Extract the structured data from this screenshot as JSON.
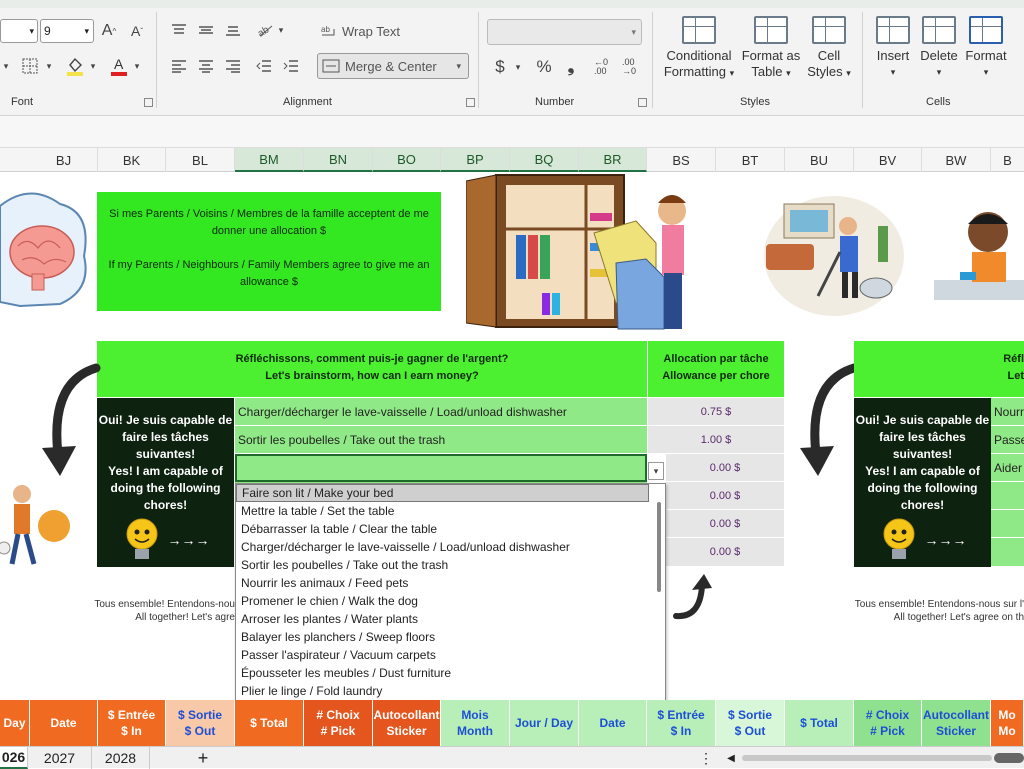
{
  "ribbon": {
    "font_size": "9",
    "font_group": "Font",
    "alignment_group": "Alignment",
    "number_group": "Number",
    "styles_group": "Styles",
    "cells_group": "Cells",
    "wrap_text": "Wrap Text",
    "merge_center": "Merge & Center",
    "conditional_formatting_1": "Conditional",
    "conditional_formatting_2": "Formatting",
    "format_as_table_1": "Format as",
    "format_as_table_2": "Table",
    "cell_styles_1": "Cell",
    "cell_styles_2": "Styles",
    "insert": "Insert",
    "delete": "Delete",
    "format": "Format"
  },
  "columns": [
    "BJ",
    "BK",
    "BL",
    "BM",
    "BN",
    "BO",
    "BP",
    "BQ",
    "BR",
    "BS",
    "BT",
    "BU",
    "BV",
    "BW",
    "B"
  ],
  "note": {
    "fr": "Si mes Parents / Voisins / Membres de la famille acceptent de me donner une allocation $",
    "en": "If my Parents / Neighbours / Family Members agree to give me an allowance $"
  },
  "brainstorm": {
    "fr": "Réfléchissons, comment puis-je gagner de l'argent?",
    "en": "Let's brainstorm, how can I earn money?"
  },
  "allowance_header": {
    "fr": "Allocation par tâche",
    "en": "Allowance per chore"
  },
  "panel": {
    "fr1": "Oui! Je suis capable de",
    "fr2": "faire les tâches",
    "fr3": "suivantes!",
    "en1": "Yes! I am capable of",
    "en2": "doing the following",
    "en3": "chores!",
    "arrows": "→→→"
  },
  "chores": [
    {
      "name": "Charger/décharger le lave-vaisselle / Load/unload dishwasher",
      "amount": "0.75 $"
    },
    {
      "name": "Sortir les poubelles / Take out the trash",
      "amount": "1.00 $"
    },
    {
      "name": "",
      "amount": "0.00 $"
    },
    {
      "name": "",
      "amount": "0.00 $"
    },
    {
      "name": "",
      "amount": "0.00 $"
    },
    {
      "name": "",
      "amount": "0.00 $"
    }
  ],
  "dropdown_options": [
    "Faire son lit / Make your bed",
    "Mettre la table / Set the table",
    "Débarrasser la table / Clear the table",
    "Charger/décharger le lave-vaisselle / Load/unload dishwasher",
    "Sortir les poubelles / Take out the trash",
    "Nourrir les animaux / Feed pets",
    "Promener le chien / Walk the dog",
    "Arroser les plantes / Water plants",
    "Balayer les planchers / Sweep floors",
    "Passer l'aspirateur / Vacuum carpets",
    "Épousseter les meubles / Dust furniture",
    "Plier le linge / Fold laundry"
  ],
  "footnote": {
    "line1": "Tous ensemble! Entendons-nou",
    "line2": "All together! Let's agre"
  },
  "right_copy": {
    "brainstorm_fr": "Réfl",
    "brainstorm_en": "Let",
    "chore1": "Nourr",
    "chore2": "Passe",
    "chore3": "Aider",
    "footnote1": "Tous ensemble! Entendons-nous sur l'",
    "footnote2": "All together! Let's agree on th"
  },
  "bottom_headers": [
    {
      "label": "Day",
      "color": "#f06a22"
    },
    {
      "label": "Date",
      "color": "#f06a22"
    },
    {
      "label": "$ Entrée\n$ In",
      "color": "#f06a22"
    },
    {
      "label": "$ Sortie\n$ Out",
      "color": "#f7c9a8"
    },
    {
      "label": "$ Total",
      "color": "#f06a22"
    },
    {
      "label": "# Choix\n# Pick",
      "color": "#e4561e"
    },
    {
      "label": "Autocollant\nSticker",
      "color": "#e4561e"
    },
    {
      "label": "Mois\nMonth",
      "color": "#b8efb8"
    },
    {
      "label": "Jour / Day",
      "color": "#b8efb8"
    },
    {
      "label": "Date",
      "color": "#b8efb8"
    },
    {
      "label": "$ Entrée\n$ In",
      "color": "#b8efb8"
    },
    {
      "label": "$ Sortie\n$ Out",
      "color": "#d8f7d8"
    },
    {
      "label": "$ Total",
      "color": "#b8efb8"
    },
    {
      "label": "# Choix\n# Pick",
      "color": "#8fe08f"
    },
    {
      "label": "Autocollant\nSticker",
      "color": "#8fe08f"
    },
    {
      "label": "Mo\nMo",
      "color": "#f06a22"
    }
  ],
  "sheet_tabs": [
    "026",
    "2027",
    "2028"
  ],
  "add_sheet": "+"
}
